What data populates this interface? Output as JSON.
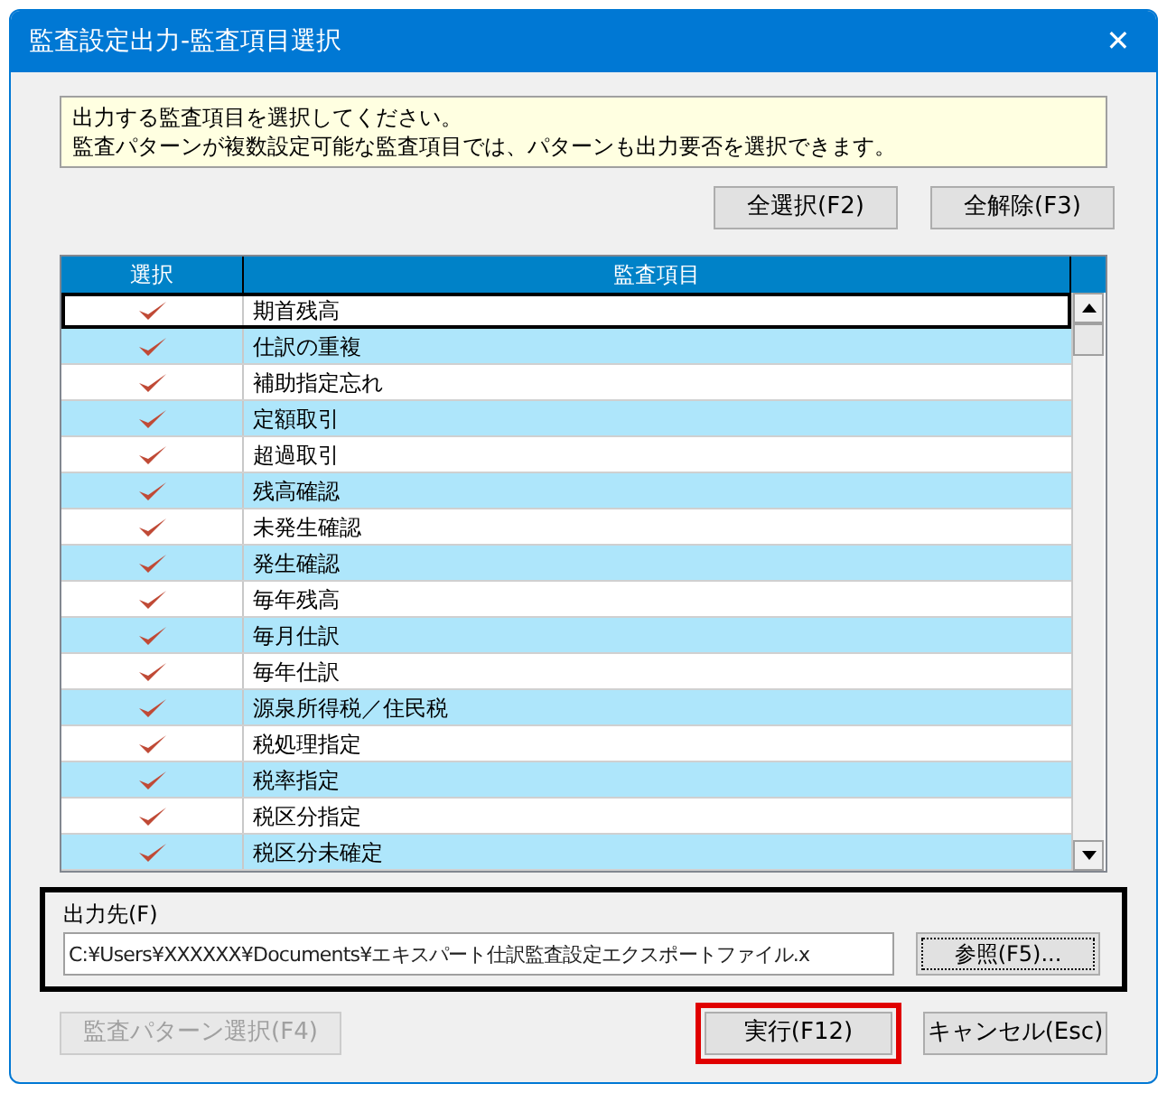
{
  "window": {
    "title": "監査設定出力-監査項目選択",
    "close_label": "✕"
  },
  "message": [
    "出力する監査項目を選択してください。",
    "監査パターンが複数設定可能な監査項目では、パターンも出力要否を選択できます。"
  ],
  "top_buttons": [
    {
      "label": "全選択(F2)"
    },
    {
      "label": "全解除(F3)"
    }
  ],
  "table": {
    "columns": [
      "選択",
      "監査項目"
    ],
    "rows": [
      {
        "item": "期首残高",
        "checked": true,
        "selected": true
      },
      {
        "item": "仕訳の重複",
        "checked": true,
        "selected": false
      },
      {
        "item": "補助指定忘れ",
        "checked": true,
        "selected": false
      },
      {
        "item": "定額取引",
        "checked": true,
        "selected": false
      },
      {
        "item": "超過取引",
        "checked": true,
        "selected": false
      },
      {
        "item": "残高確認",
        "checked": true,
        "selected": false
      },
      {
        "item": "未発生確認",
        "checked": true,
        "selected": false
      },
      {
        "item": "発生確認",
        "checked": true,
        "selected": false
      },
      {
        "item": "毎年残高",
        "checked": true,
        "selected": false
      },
      {
        "item": "毎月仕訳",
        "checked": true,
        "selected": false
      },
      {
        "item": "毎年仕訳",
        "checked": true,
        "selected": false
      },
      {
        "item": "源泉所得税／住民税",
        "checked": true,
        "selected": false
      },
      {
        "item": "税処理指定",
        "checked": true,
        "selected": false
      },
      {
        "item": "税率指定",
        "checked": true,
        "selected": false
      },
      {
        "item": "税区分指定",
        "checked": true,
        "selected": false
      },
      {
        "item": "税区分未確定",
        "checked": true,
        "selected": false
      }
    ]
  },
  "output": {
    "label": "出力先(F)",
    "value": "C:¥Users¥XXXXXX¥Documents¥エキスパート仕訳監査設定エクスポートファイル.x",
    "browse_button": "参照(F5)...",
    "highlighted": true
  },
  "bottom_buttons": [
    {
      "label": "監査パターン選択(F4)",
      "disabled": true
    },
    {
      "label": "実行(F12)",
      "disabled": false,
      "highlighted": true
    },
    {
      "label": "キャンセル(Esc)",
      "disabled": false
    }
  ]
}
